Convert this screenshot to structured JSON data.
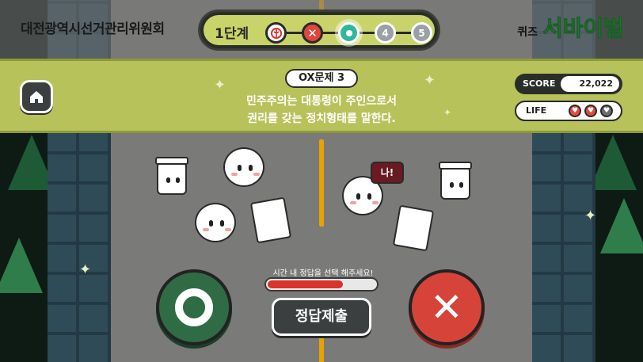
{
  "header": {
    "organization": "대전광역시선거관리위원회",
    "stage_label": "1단계",
    "steps": [
      {
        "label": "",
        "state": "correct"
      },
      {
        "label": "",
        "state": "wrong"
      },
      {
        "label": "",
        "state": "current"
      },
      {
        "label": "4",
        "state": "upcoming"
      },
      {
        "label": "5",
        "state": "upcoming"
      }
    ],
    "quiz_small": "퀴즈",
    "quiz_title": "서바이벌"
  },
  "question": {
    "badge": "OX문제 3",
    "line1": "민주주의는 대통령이 주인으로서",
    "line2": "권리를 갖는 정치형태를 말한다."
  },
  "score": {
    "label": "SCORE",
    "value": "22,022"
  },
  "life": {
    "label": "LIFE",
    "total": 3,
    "remaining": 2
  },
  "speech_bubble": "나!",
  "timer": {
    "text": "시간 내 정답을 선택 해주세요!",
    "fraction_remaining": 0.7
  },
  "submit_label": "정답제출",
  "icons": {
    "home": "home-icon",
    "o_answer": "o-answer-icon",
    "x_answer": "x-answer-icon"
  },
  "colors": {
    "banner": "#b7c25a",
    "timer_fill": "#d9332b",
    "o_button": "#2f6b45",
    "x_button": "#d64439",
    "heart_full": "#e24b3b",
    "heart_empty": "#6b6b6b"
  }
}
